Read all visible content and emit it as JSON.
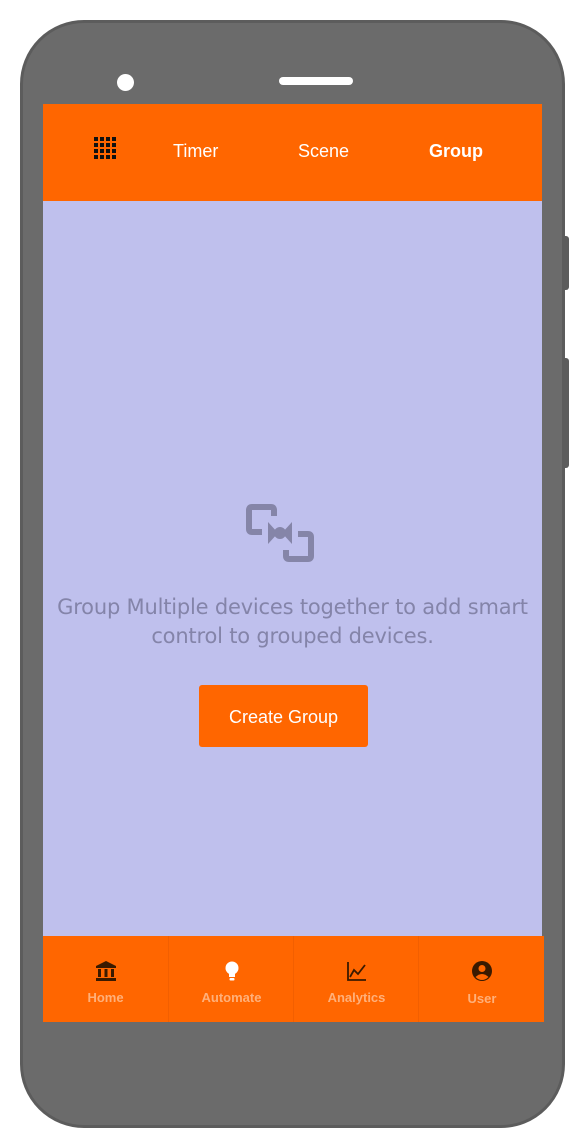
{
  "topbar": {
    "menu_icon": "grid-icon",
    "tabs": [
      {
        "label": "Timer",
        "active": false
      },
      {
        "label": "Scene",
        "active": false
      },
      {
        "label": "Group",
        "active": true
      }
    ]
  },
  "empty_state": {
    "icon": "group-devices-icon",
    "message": "Group Multiple devices together to add smart control to grouped devices.",
    "button_label": "Create Group"
  },
  "bottom_nav": {
    "items": [
      {
        "label": "Home",
        "icon": "bank-icon"
      },
      {
        "label": "Automate",
        "icon": "lightbulb-icon"
      },
      {
        "label": "Analytics",
        "icon": "line-chart-icon"
      },
      {
        "label": "User",
        "icon": "account-circle-icon"
      }
    ]
  },
  "colors": {
    "accent": "#ff6600",
    "screen_background": "#bfc0ed",
    "muted_text": "#8484a9",
    "nav_label": "#ffb07a",
    "phone_frame": "#6b6b6b"
  }
}
